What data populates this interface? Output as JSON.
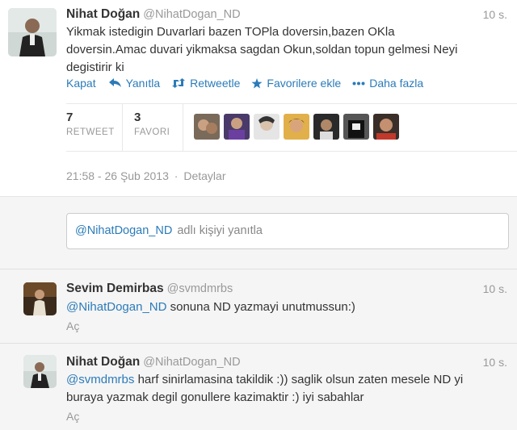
{
  "main_tweet": {
    "name": "Nihat Doğan",
    "handle": "@NihatDogan_ND",
    "time": "10 s.",
    "text_line1": "Yikmak istedigin Duvarlari bazen TOPla doversin,bazen OKla",
    "text_line2": "doversin.Amac duvari yikmaksa sagdan Okun,soldan topun gelmesi Neyi",
    "text_line3": "degistirir ki",
    "actions": {
      "collapse": "Kapat",
      "reply": "Yanıtla",
      "retweet": "Retweetle",
      "favorite": "Favorilere ekle",
      "more": "Daha fazla"
    },
    "stats": {
      "retweet_count": "7",
      "retweet_label": "RETWEET",
      "favorite_count": "3",
      "favorite_label": "FAVORI"
    },
    "timestamp": "21:58 - 26 Şub 2013",
    "separator": "·",
    "details": "Detaylar"
  },
  "reply_box": {
    "mention": "@NihatDogan_ND",
    "placeholder": "adlı kişiyi yanıtla"
  },
  "replies": [
    {
      "name": "Sevim Demirbas",
      "handle": "@svmdmrbs",
      "time": "10 s.",
      "mention": "@NihatDogan_ND",
      "text_line1": "sonuna ND yazmayi unutmussun:)",
      "open": "Aç"
    },
    {
      "name": "Nihat Doğan",
      "handle": "@NihatDogan_ND",
      "time": "10 s.",
      "mention": "@svmdmrbs",
      "text_line1": "harf sinirlamasina takildik :)) saglik olsun zaten mesele ND yi",
      "text_line2": "buraya yazmak degil gonullere kazimaktir :) iyi sabahlar",
      "open": "Aç"
    }
  ],
  "colors": {
    "link": "#2b7bb9",
    "muted": "#999999",
    "text": "#333333",
    "gray_bg": "#f5f5f5"
  },
  "icons": [
    "reply-icon",
    "retweet-icon",
    "star-icon",
    "more-dots-icon"
  ]
}
